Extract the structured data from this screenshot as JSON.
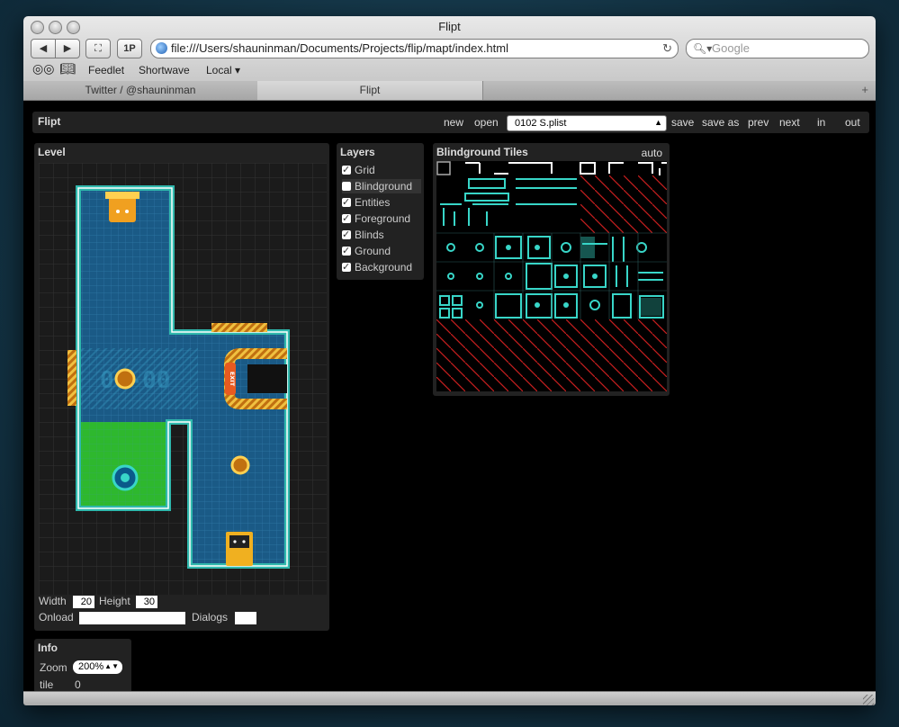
{
  "window": {
    "title": "Flipt"
  },
  "toolbar": {
    "back": "◀",
    "forward": "▶",
    "fullscreen": "⛶",
    "one_p": "1P",
    "url": "file:///Users/shauninman/Documents/Projects/flip/mapt/index.html",
    "search_placeholder": "Google"
  },
  "bookmarks": [
    {
      "label": "Feedlet"
    },
    {
      "label": "Shortwave"
    },
    {
      "label": "Local ▾"
    }
  ],
  "tabs": [
    {
      "label": "Twitter / @shauninman",
      "active": false
    },
    {
      "label": "Flipt",
      "active": true
    }
  ],
  "app": {
    "brand": "Flipt",
    "actions": {
      "new": "new",
      "open": "open",
      "save": "save",
      "save_as": "save as",
      "prev": "prev",
      "next": "next",
      "in": "in",
      "out": "out"
    },
    "file": "0102 S.plist"
  },
  "level": {
    "title": "Level",
    "width_label": "Width",
    "width_value": "20",
    "height_label": "Height",
    "height_value": "30",
    "onload_label": "Onload",
    "onload_value": "",
    "dialogs_label": "Dialogs",
    "dialogs_value": "",
    "door_sign": "EXIT"
  },
  "layers": {
    "title": "Layers",
    "items": [
      {
        "label": "Grid",
        "checked": true
      },
      {
        "label": "Blindground",
        "checked": false
      },
      {
        "label": "Entities",
        "checked": true
      },
      {
        "label": "Foreground",
        "checked": true
      },
      {
        "label": "Blinds",
        "checked": true
      },
      {
        "label": "Ground",
        "checked": true
      },
      {
        "label": "Background",
        "checked": true
      }
    ]
  },
  "tiles": {
    "title": "Blindground Tiles",
    "auto": "auto"
  },
  "info": {
    "title": "Info",
    "zoom_label": "Zoom",
    "zoom_value": "200%",
    "tile_label": "tile",
    "tile_value": "0"
  },
  "colors": {
    "water": "#1a5a86",
    "wall": "#38d6c8",
    "green": "#2eb82e",
    "accent": "#f0a020",
    "invalid": "#c81e1e"
  }
}
